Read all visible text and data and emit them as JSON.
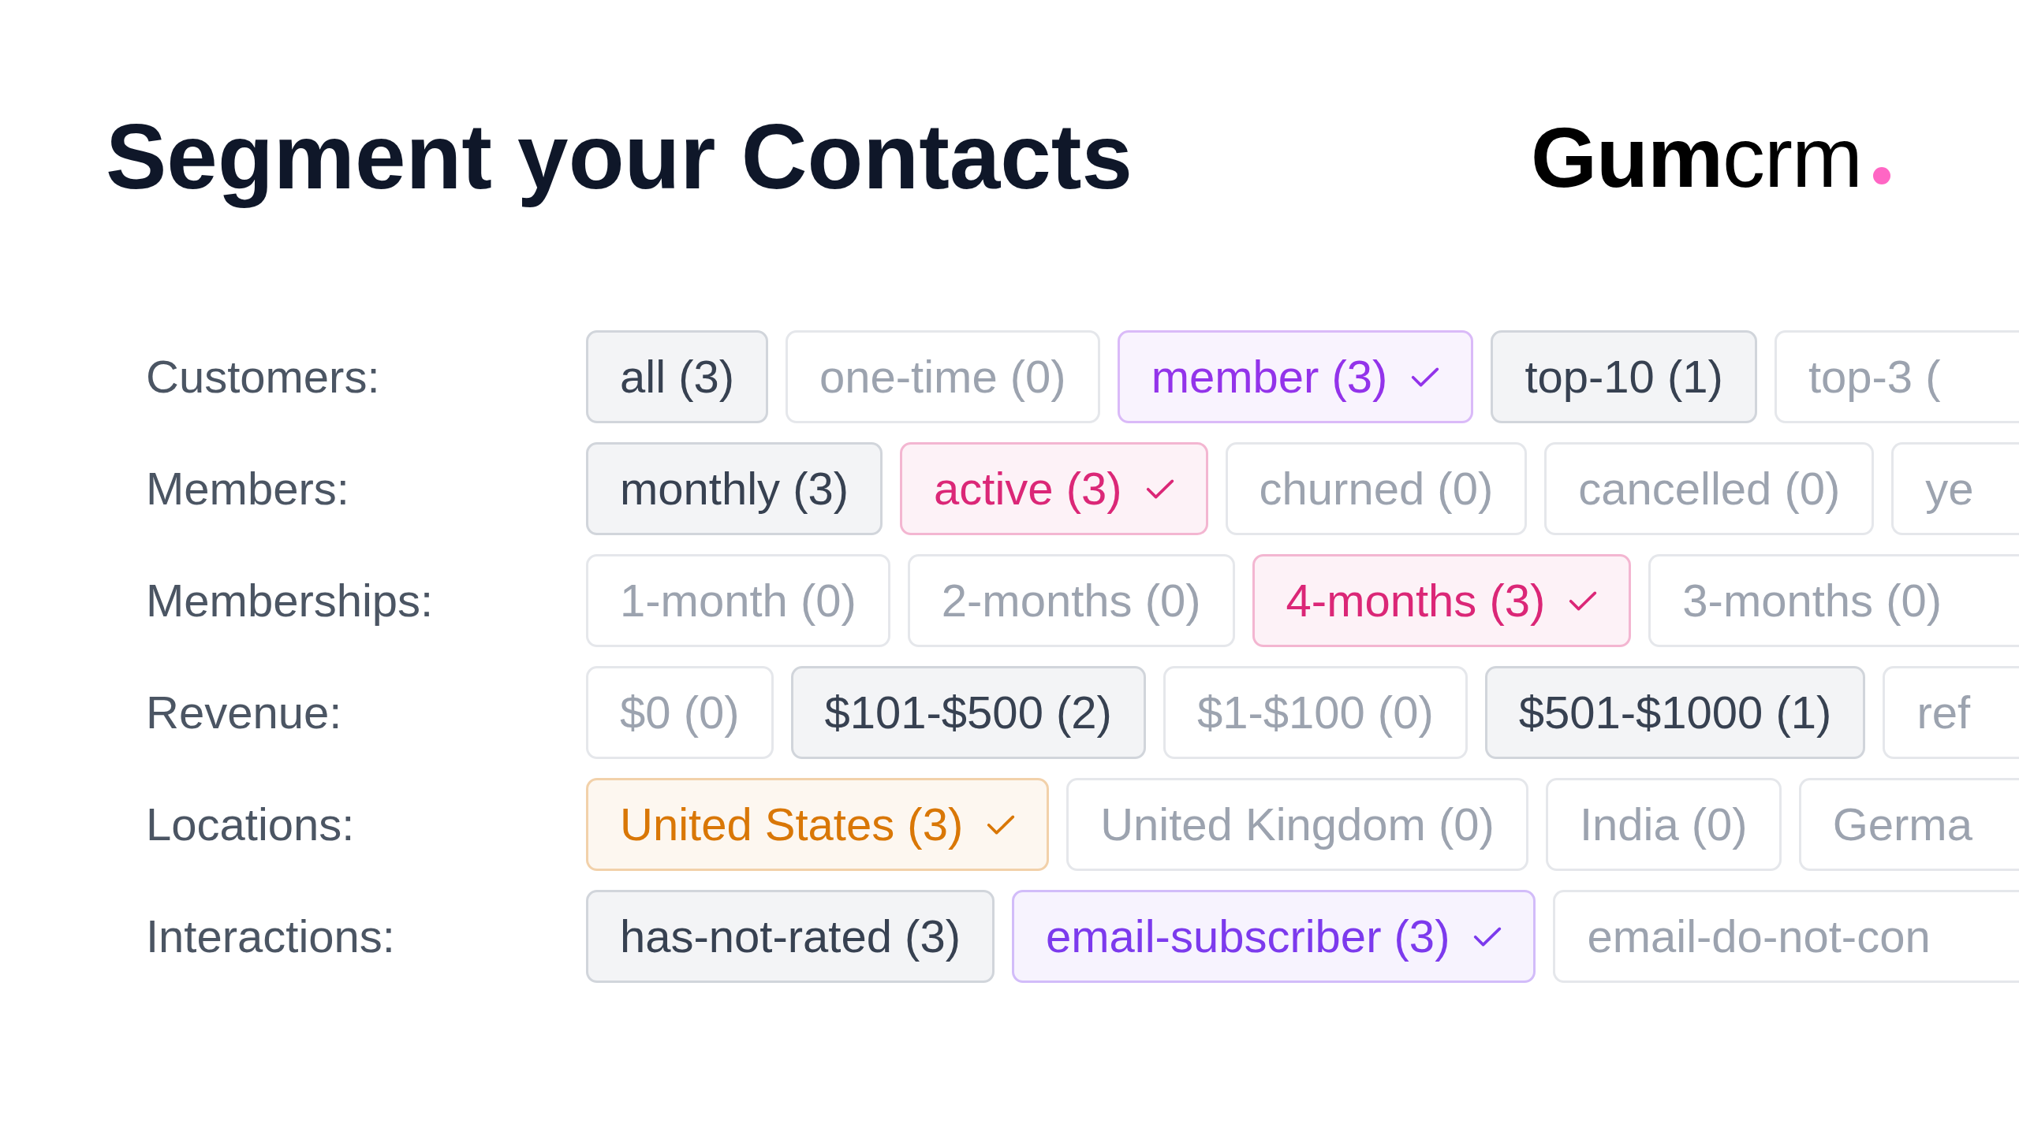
{
  "header": {
    "title": "Segment your Contacts",
    "logo": "**Gum**crm"
  },
  "rows": [
    {
      "label": "Customers:",
      "chips": [
        {
          "text": "all (3)",
          "selected": false,
          "disabled": false
        },
        {
          "text": "one-time (0)",
          "selected": false,
          "disabled": true
        },
        {
          "text": "member (3)",
          "selected": true,
          "disabled": false,
          "color": "#9333ea"
        },
        {
          "text": "top-10 (1)",
          "selected": false,
          "disabled": false
        },
        {
          "text": "top-3 (",
          "selected": false,
          "disabled": true
        }
      ]
    },
    {
      "label": "Members:",
      "chips": [
        {
          "text": "monthly (3)",
          "selected": false,
          "disabled": false
        },
        {
          "text": "active (3)",
          "selected": true,
          "disabled": false,
          "color": "#db2777"
        },
        {
          "text": "churned (0)",
          "selected": false,
          "disabled": true
        },
        {
          "text": "cancelled (0)",
          "selected": false,
          "disabled": true
        },
        {
          "text": "ye",
          "selected": false,
          "disabled": true
        }
      ]
    },
    {
      "label": "Memberships:",
      "chips": [
        {
          "text": "1-month (0)",
          "selected": false,
          "disabled": true
        },
        {
          "text": "2-months (0)",
          "selected": false,
          "disabled": true
        },
        {
          "text": "4-months (3)",
          "selected": true,
          "disabled": false,
          "color": "#db2777"
        },
        {
          "text": "3-months (0)",
          "selected": false,
          "disabled": true
        }
      ]
    },
    {
      "label": "Revenue:",
      "chips": [
        {
          "text": "$0 (0)",
          "selected": false,
          "disabled": true
        },
        {
          "text": "$101-$500 (2)",
          "selected": false,
          "disabled": false
        },
        {
          "text": "$1-$100 (0)",
          "selected": false,
          "disabled": true
        },
        {
          "text": "$501-$1000 (1)",
          "selected": false,
          "disabled": false
        },
        {
          "text": "ref",
          "selected": false,
          "disabled": true
        }
      ]
    },
    {
      "label": "Locations:",
      "chips": [
        {
          "text": "United States (3)",
          "selected": true,
          "disabled": false,
          "color": "#d97706"
        },
        {
          "text": "United Kingdom (0)",
          "selected": false,
          "disabled": true
        },
        {
          "text": "India (0)",
          "selected": false,
          "disabled": true
        },
        {
          "text": "Germa",
          "selected": false,
          "disabled": true
        }
      ]
    },
    {
      "label": "Interactions:",
      "chips": [
        {
          "text": "has-not-rated (3)",
          "selected": false,
          "disabled": false
        },
        {
          "text": "email-subscriber (3)",
          "selected": true,
          "disabled": false,
          "color": "#7c3aed"
        },
        {
          "text": "email-do-not-con",
          "selected": false,
          "disabled": true
        }
      ]
    }
  ]
}
